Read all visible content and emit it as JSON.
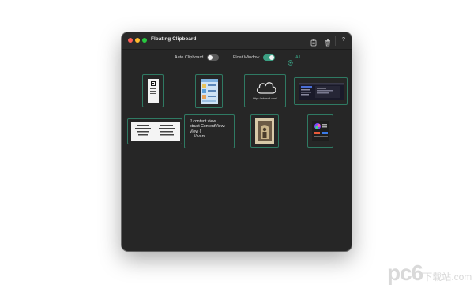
{
  "window": {
    "title": "Floating Clipboard"
  },
  "toolbar": {
    "clipboard_icon": "clipboard-icon",
    "trash_icon": "trash-icon",
    "help_label": "?"
  },
  "controls": {
    "auto_clipboard_label": "Auto Clipboard",
    "auto_clipboard_on": false,
    "float_window_label": "Float Window",
    "float_window_on": true,
    "all_label": "All"
  },
  "items": [
    {
      "type": "image",
      "kind": "qr-label-thumbnail"
    },
    {
      "type": "image",
      "kind": "app-screenshot-thumbnail"
    },
    {
      "type": "link",
      "kind": "cloud-link",
      "url": "https://abcsoft.com/"
    },
    {
      "type": "image",
      "kind": "dark-window-thumbnail"
    },
    {
      "type": "image",
      "kind": "ip-table-thumbnail"
    },
    {
      "type": "text",
      "text": "// content view\nstruct ContentView:\nView {\n    // vars..."
    },
    {
      "type": "image",
      "kind": "vintage-photo-thumbnail"
    },
    {
      "type": "image",
      "kind": "color-picker-thumbnail"
    }
  ],
  "colors": {
    "accent": "#3a9e82",
    "window_bg": "#262626",
    "item_border": "#2f7a63"
  },
  "watermark": {
    "main": "pc6",
    "sub": "下载站",
    "domain": ".com"
  }
}
